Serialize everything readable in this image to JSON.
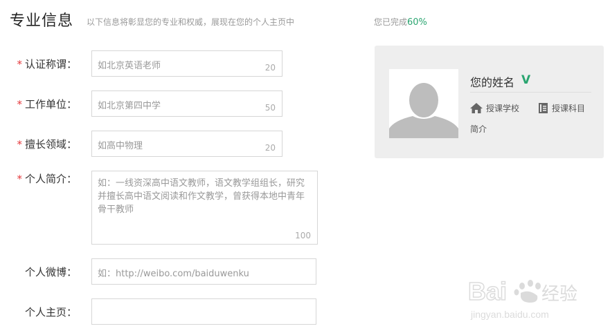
{
  "header": {
    "title": "专业信息",
    "subtitle": "以下信息将彰显您的专业和权威，展现在您的个人主页中",
    "progress_prefix": "您已完成",
    "progress_value": "60%"
  },
  "form": {
    "fields": [
      {
        "label": "认证称谓：",
        "required": true,
        "placeholder": "如北京英语老师",
        "max": "20"
      },
      {
        "label": "工作单位：",
        "required": true,
        "placeholder": "如北京第四中学",
        "max": "50"
      },
      {
        "label": "擅长领域：",
        "required": true,
        "placeholder": "如高中物理",
        "max": "20"
      },
      {
        "label": "个人简介：",
        "required": true,
        "placeholder": "如：一线资深高中语文教师，语文教学组组长，研究并擅长高中语文阅读和作文教学，曾获得本地中青年骨干教师",
        "max": "100"
      },
      {
        "label": "个人微博：",
        "required": false,
        "placeholder": "如：http://weibo.com/baiduwenku",
        "max": ""
      },
      {
        "label": "个人主页：",
        "required": false,
        "placeholder": "",
        "max": ""
      }
    ],
    "required_mark": "*"
  },
  "preview_card": {
    "name": "您的姓名",
    "verified_mark": "V",
    "school_label": "授课学校",
    "subject_label": "授课科目",
    "intro_label": "简介",
    "icons": [
      "home-icon",
      "book-icon"
    ]
  },
  "watermark": {
    "brand": "Baidu经验",
    "url": "jingyan.baidu.com"
  },
  "colors": {
    "accent": "#2aa570",
    "required": "#e4393c",
    "card_bg": "#eeeeee"
  }
}
